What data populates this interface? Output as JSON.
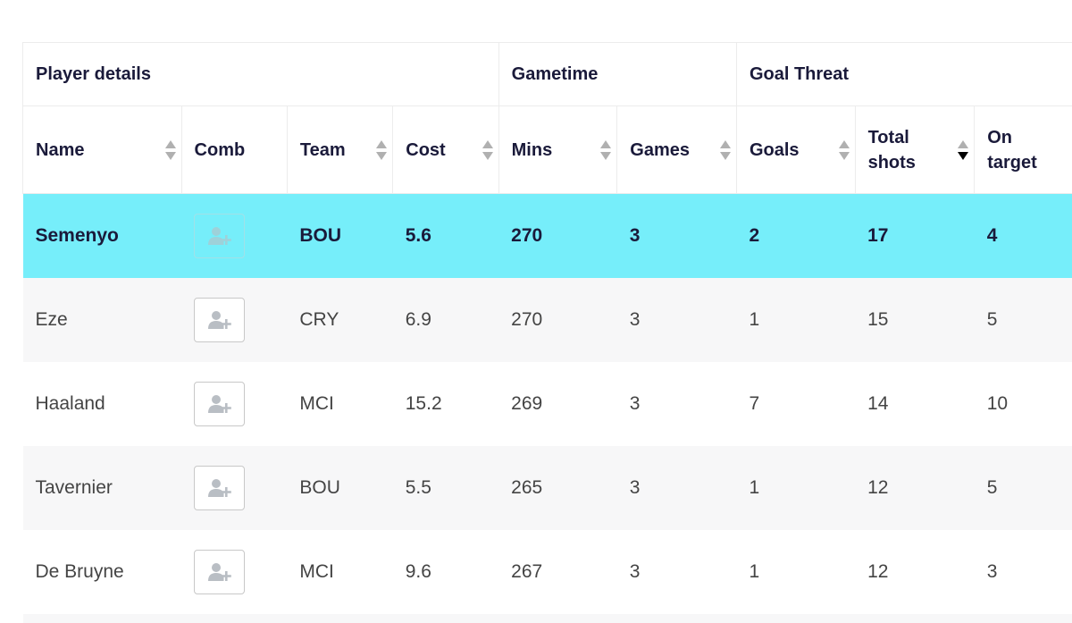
{
  "groups": [
    {
      "label": "Player details"
    },
    {
      "label": "Gametime"
    },
    {
      "label": "Goal Threat"
    }
  ],
  "columns": [
    {
      "key": "name",
      "label": "Name",
      "sortable": true,
      "sort": "none"
    },
    {
      "key": "comb",
      "label": "Comb",
      "sortable": false
    },
    {
      "key": "team",
      "label": "Team",
      "sortable": true,
      "sort": "none"
    },
    {
      "key": "cost",
      "label": "Cost",
      "sortable": true,
      "sort": "none"
    },
    {
      "key": "mins",
      "label": "Mins",
      "sortable": true,
      "sort": "none"
    },
    {
      "key": "games",
      "label": "Games",
      "sortable": true,
      "sort": "none"
    },
    {
      "key": "goals",
      "label": "Goals",
      "sortable": true,
      "sort": "none"
    },
    {
      "key": "shots",
      "label": "Total shots",
      "sortable": true,
      "sort": "desc"
    },
    {
      "key": "ont",
      "label": "On target",
      "sortable": true,
      "sort": "none"
    }
  ],
  "icons": {
    "comb": "add-user-icon"
  },
  "colors": {
    "highlight": "#76eefa",
    "alt_row": "#f7f7f8"
  },
  "rows": [
    {
      "name": "Semenyo",
      "team": "BOU",
      "cost": "5.6",
      "mins": "270",
      "games": "3",
      "goals": "2",
      "shots": "17",
      "ont": "4",
      "highlighted": true
    },
    {
      "name": "Eze",
      "team": "CRY",
      "cost": "6.9",
      "mins": "270",
      "games": "3",
      "goals": "1",
      "shots": "15",
      "ont": "5"
    },
    {
      "name": "Haaland",
      "team": "MCI",
      "cost": "15.2",
      "mins": "269",
      "games": "3",
      "goals": "7",
      "shots": "14",
      "ont": "10"
    },
    {
      "name": "Tavernier",
      "team": "BOU",
      "cost": "5.5",
      "mins": "265",
      "games": "3",
      "goals": "1",
      "shots": "12",
      "ont": "5"
    },
    {
      "name": "De Bruyne",
      "team": "MCI",
      "cost": "9.6",
      "mins": "267",
      "games": "3",
      "goals": "1",
      "shots": "12",
      "ont": "3"
    }
  ]
}
